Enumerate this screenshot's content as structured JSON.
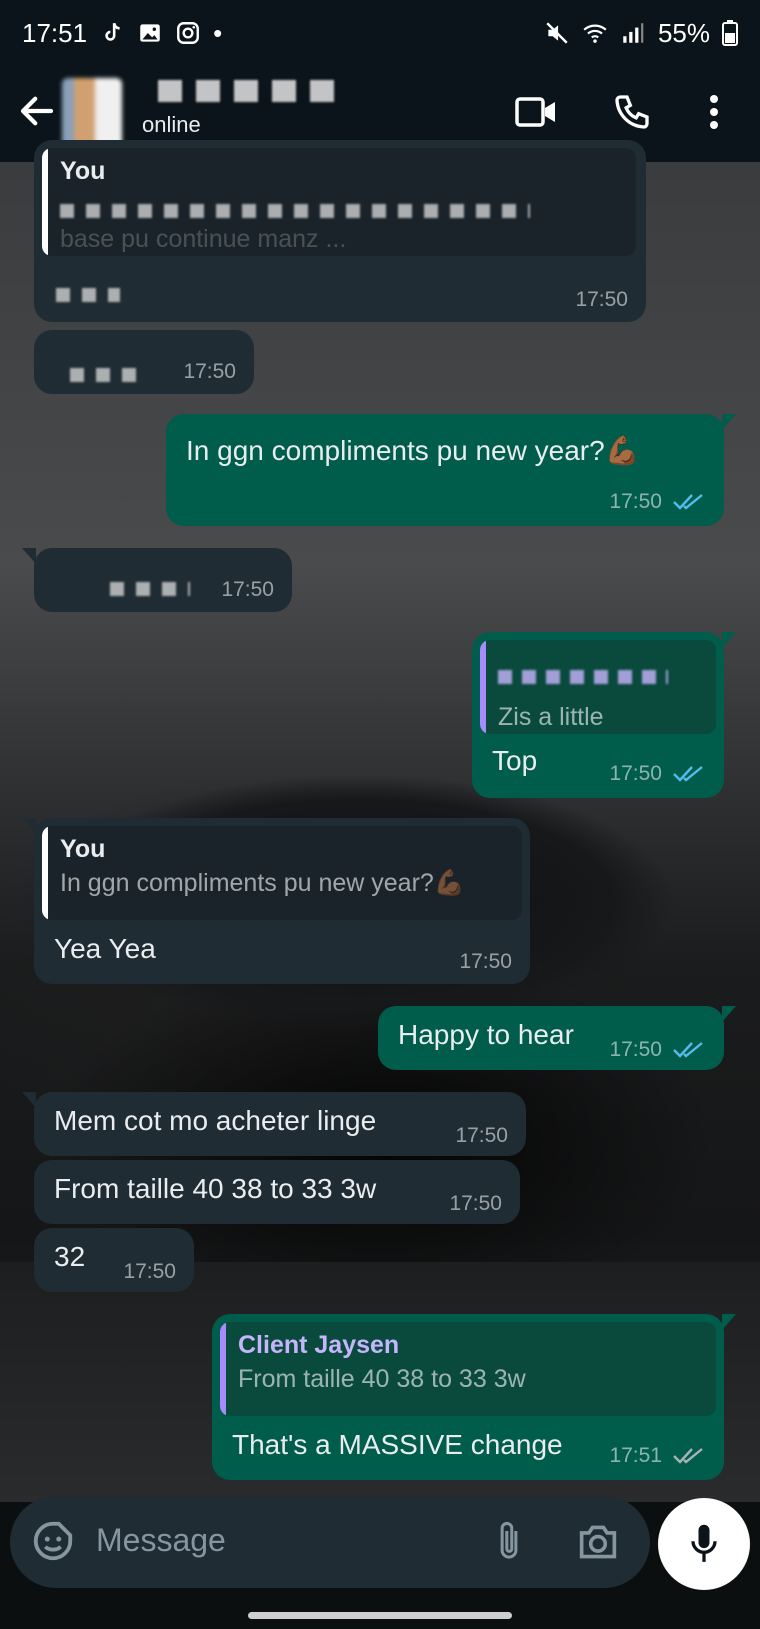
{
  "status_bar": {
    "time": "17:51",
    "battery": "55%",
    "notification_dot": "•",
    "icons": [
      "tiktok-icon",
      "gallery-icon",
      "instagram-icon",
      "mute-icon",
      "wifi-icon",
      "signal-icon",
      "battery-icon"
    ]
  },
  "header": {
    "contact_status": "online"
  },
  "messages": [
    {
      "dir": "in",
      "quote_author": "You",
      "quote_text": "base pu continue manz ...",
      "time": "17:50"
    },
    {
      "dir": "in",
      "time": "17:50"
    },
    {
      "dir": "out",
      "text": "In ggn compliments pu new year?💪🏾",
      "time": "17:50",
      "status": "read"
    },
    {
      "dir": "in",
      "time": "17:50"
    },
    {
      "dir": "out",
      "quote_text": "Zis a little",
      "text": "Top",
      "time": "17:50",
      "status": "read"
    },
    {
      "dir": "in",
      "quote_author": "You",
      "quote_text": "In ggn compliments pu new year?💪🏾",
      "text": "Yea Yea",
      "time": "17:50"
    },
    {
      "dir": "out",
      "text": "Happy to hear",
      "time": "17:50",
      "status": "read"
    },
    {
      "dir": "in",
      "text": "Mem cot mo acheter linge",
      "time": "17:50"
    },
    {
      "dir": "in",
      "text": "From taille 40 38 to 33 3w",
      "time": "17:50"
    },
    {
      "dir": "in",
      "text": "32",
      "time": "17:50"
    },
    {
      "dir": "out",
      "quote_author": "Client Jaysen",
      "quote_text": "From taille 40 38 to 33 3w",
      "text": "That's a MASSIVE change",
      "time": "17:51",
      "status": "delivered"
    }
  ],
  "composer": {
    "placeholder": "Message"
  },
  "colors": {
    "header_bg": "#0b141a",
    "incoming_bubble": "#202c33",
    "outgoing_bubble": "#005c4b",
    "read_tick": "#53bdeb",
    "quote_accent_out": "#a78bfa"
  }
}
